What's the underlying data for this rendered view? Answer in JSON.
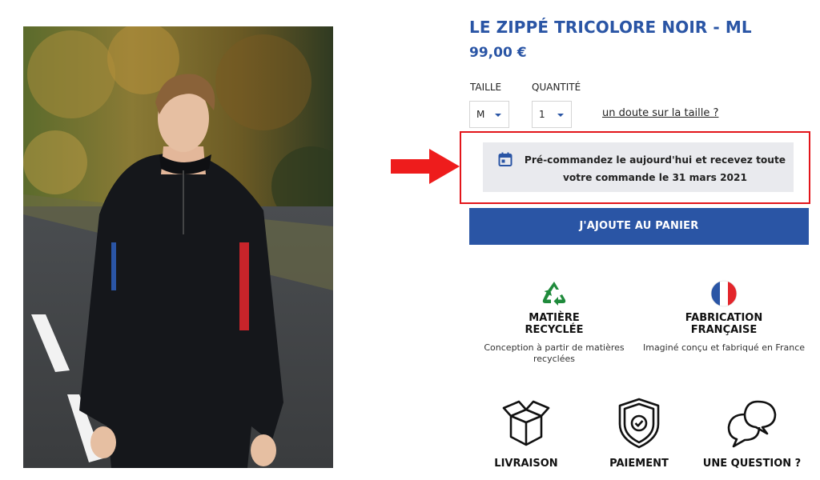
{
  "product": {
    "title": "LE ZIPPÉ TRICOLORE NOIR - ML",
    "price": "99,00 €"
  },
  "options": {
    "size_label": "TAILLE",
    "size_value": "M",
    "quantity_label": "QUANTITÉ",
    "quantity_value": "1",
    "size_help_link": "un doute sur la taille ?"
  },
  "preorder": {
    "icon": "calendar-icon",
    "text_line1": "Pré-commandez le aujourd'hui et recevez toute",
    "text_line2": "votre commande le 31 mars 2021"
  },
  "cart": {
    "button_label": "J'AJOUTE AU PANIER"
  },
  "features": [
    {
      "icon": "recycle-icon",
      "title_line1": "MATIÈRE",
      "title_line2": "RECYCLÉE",
      "desc_line1": "Conception à partir de matières",
      "desc_line2": "recyclées"
    },
    {
      "icon": "french-flag-icon",
      "title_line1": "FABRICATION",
      "title_line2": "FRANÇAISE",
      "desc_line1": "Imaginé conçu et fabriqué en France",
      "desc_line2": ""
    }
  ],
  "services": [
    {
      "icon": "box-icon",
      "label": "LIVRAISON"
    },
    {
      "icon": "shield-check-icon",
      "label": "PAIEMENT"
    },
    {
      "icon": "chat-bubbles-icon",
      "label": "UNE QUESTION ?"
    }
  ],
  "colors": {
    "brand_blue": "#2a55a5",
    "highlight_red": "#e3151a",
    "notice_bg": "#e9eaee",
    "recycle_green": "#1f8a3b"
  }
}
